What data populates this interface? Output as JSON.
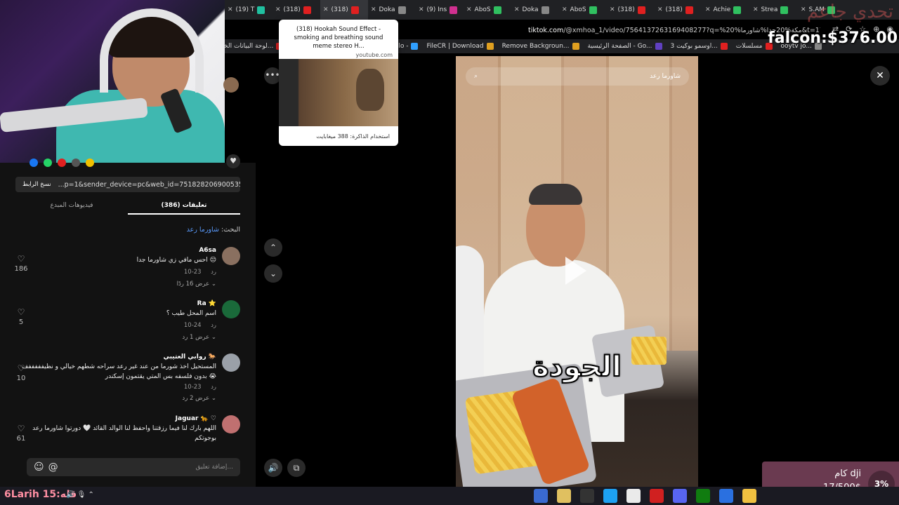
{
  "tabs": [
    {
      "label": "(19) T",
      "color": "#20c0a0"
    },
    {
      "label": "(318)",
      "color": "#e02020"
    },
    {
      "label": "(318)",
      "color": "#e02020",
      "active": true
    },
    {
      "label": "Doka",
      "color": "#888888"
    },
    {
      "label": "(9) Ins",
      "color": "#d03090"
    },
    {
      "label": "AboS",
      "color": "#30c060"
    },
    {
      "label": "Doka",
      "color": "#888888"
    },
    {
      "label": "AboS",
      "color": "#30c060"
    },
    {
      "label": "(318)",
      "color": "#e02020"
    },
    {
      "label": "(318)",
      "color": "#e02020"
    },
    {
      "label": "Achie",
      "color": "#30c060"
    },
    {
      "label": "Strea",
      "color": "#30c060"
    },
    {
      "label": "S.AM",
      "color": "#30c060"
    }
  ],
  "address": {
    "domain": "tiktok.com",
    "path": "/@xmhoa_1/video/7564137263169408277?q=%20%مكة%20جدا%شاورما&t=1766770775046"
  },
  "bookmarks": [
    {
      "label": "لوحة البيانات الخاصة...",
      "color": "#e02020"
    },
    {
      "label": "Gmail",
      "color": "#e04030"
    },
    {
      "label": "نسخ و لص...",
      "color": "#f0c000"
    },
    {
      "label": "Emojilo -",
      "color": "#30a0ff"
    },
    {
      "label": "FileCR | Download",
      "color": "#e0a020"
    },
    {
      "label": "Remove Backgroun...",
      "color": "#e0a020"
    },
    {
      "label": "الصفحة الرئيسية - Go...",
      "color": "#6040c0"
    },
    {
      "label": "اوسمو بوكيت 3...",
      "color": "#e02020"
    },
    {
      "label": "مسلسلات",
      "color": "#e02020"
    },
    {
      "label": "ooytv jo...",
      "color": "#888888"
    }
  ],
  "overlay": {
    "watermark": "تحدي جاعم",
    "falcon": "falcon:$376.00"
  },
  "tooltip": {
    "title": "(318) Hookah Sound Effect - smoking and breathing sound meme stereo H...",
    "site": "youtube.com",
    "memory": "استخدام الذاكرة: 388 ميغابايت"
  },
  "left": {
    "copy_button": "نسخ الرابط",
    "copy_url": "...p=1&sender_device=pc&web_id=7518282069005354514",
    "tab_comments": "تعليقات (386)",
    "tab_creator": "فيديوهات المبدع",
    "search_prefix": "البحث:",
    "search_query": "شاورما رعد",
    "comment_placeholder": "إضافة تعليق..."
  },
  "comments": [
    {
      "name": "A6sa",
      "text": "احس مافي زي شاورما جدا 😔",
      "date": "10-23",
      "reply": "رد",
      "more": "عرض 16 ردًا ⌄",
      "likes": "186"
    },
    {
      "name": "Ra ⭐",
      "text": "اسم المحل طيب ؟",
      "date": "10-24",
      "reply": "رد",
      "more": "عرض 1 رد ⌄",
      "likes": "5"
    },
    {
      "name": "روابي العتيبي 🐎",
      "text": "المستحيل اخذ شورما من عند غير رعد سراحه شطهم خيالي و نظيفففففف بدون فلسفه بس المتي يقتمون إسكندر 😭",
      "date": "10-23",
      "reply": "رد",
      "more": "عرض 2 رد ⌄",
      "likes": "10"
    },
    {
      "name": "Jaguar 🐆 ♡",
      "text": "اللهم بارك لنا فيما رزقتنا واحفظ لنا الوالد القائد 🤍 دورتوا شاورما رعد بوجوتكم",
      "date": "",
      "reply": "",
      "more": "",
      "likes": "61"
    }
  ],
  "video": {
    "search_text": "شاورما رعد",
    "caption": "الجودة"
  },
  "goal": {
    "label": "كام dji",
    "value": "17/500$",
    "percent": "3%"
  },
  "taskbar": {
    "clock": "6Larih 15:قله",
    "sys": "🔊 🎙 ⌃"
  }
}
